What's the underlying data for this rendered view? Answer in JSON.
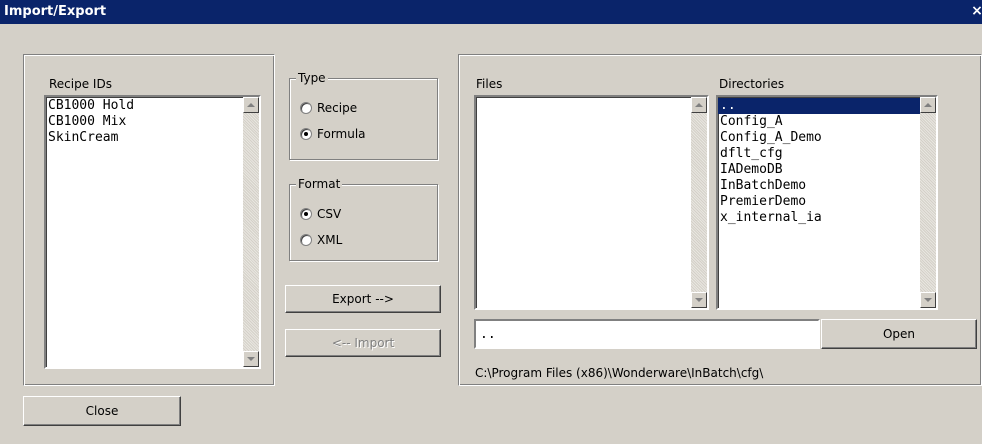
{
  "window": {
    "title": "Import/Export",
    "close_glyph": "×"
  },
  "recipe_ids": {
    "label": "Recipe IDs",
    "items": [
      "CB1000 Hold",
      "CB1000 Mix",
      "SkinCream"
    ]
  },
  "type_group": {
    "legend": "Type",
    "options": [
      {
        "label": "Recipe",
        "selected": false
      },
      {
        "label": "Formula",
        "selected": true
      }
    ]
  },
  "format_group": {
    "legend": "Format",
    "options": [
      {
        "label": "CSV",
        "selected": true
      },
      {
        "label": "XML",
        "selected": false
      }
    ]
  },
  "buttons": {
    "export": "Export -->",
    "import": "<-- Import",
    "open": "Open",
    "close": "Close"
  },
  "files": {
    "label": "Files",
    "items": []
  },
  "directories": {
    "label": "Directories",
    "items": [
      "..",
      "Config_A",
      "Config_A_Demo",
      "dflt_cfg",
      "IADemoDB",
      "InBatchDemo",
      "PremierDemo",
      "x_internal_ia"
    ],
    "selected_index": 0
  },
  "path_input": {
    "value": ".."
  },
  "current_path": "C:\\Program Files (x86)\\Wonderware\\InBatch\\cfg\\",
  "colors": {
    "face": "#d4d0c8",
    "titlebar": "#0a246a",
    "selection": "#0a246a"
  },
  "icons": {
    "scroll_up": "scroll-up-arrow-icon",
    "scroll_down": "scroll-down-arrow-icon"
  }
}
